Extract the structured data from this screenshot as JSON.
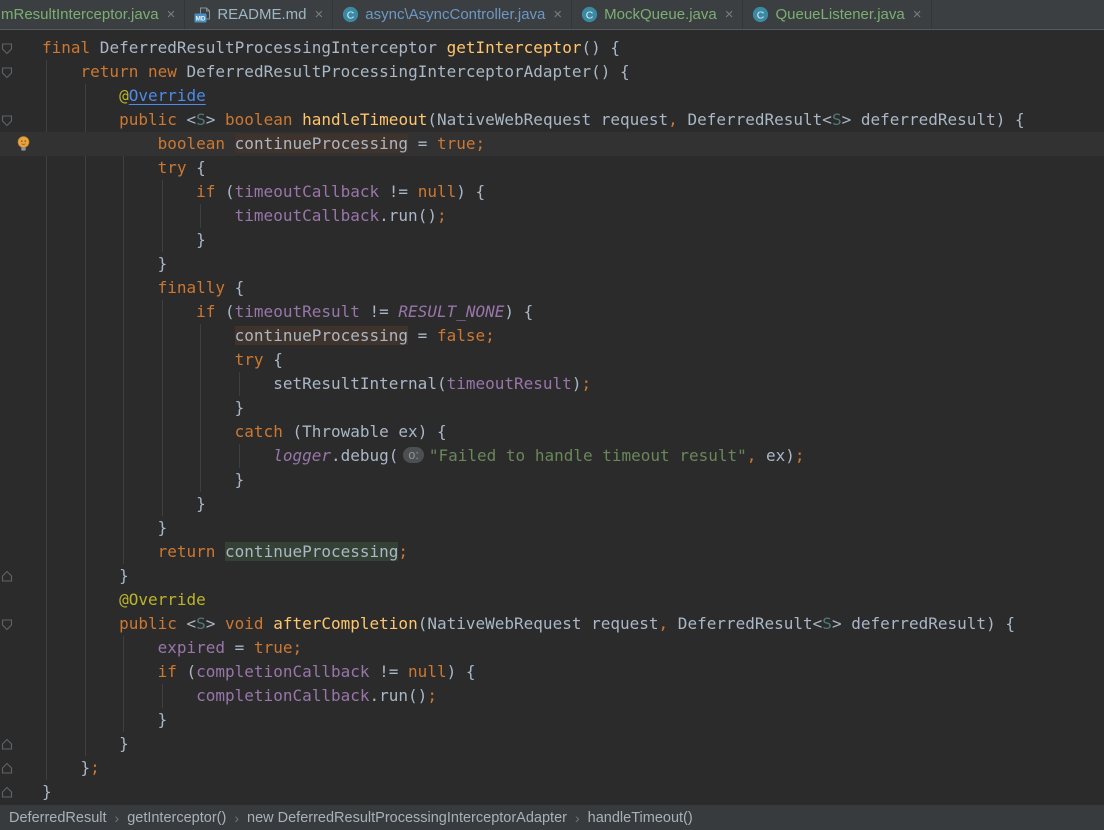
{
  "tab_bar": {
    "close_glyph": "×",
    "tabs": [
      {
        "label": "mResultInterceptor.java",
        "label_color": "#7CAE73",
        "icon": "none",
        "selected": true
      },
      {
        "label": "README.md",
        "label_color": "#9FB6C4",
        "icon": "markdown",
        "selected": false
      },
      {
        "label": "async\\AsyncController.java",
        "label_color": "#6D98C4",
        "icon": "class",
        "selected": false
      },
      {
        "label": "MockQueue.java",
        "label_color": "#7CAE73",
        "icon": "class",
        "selected": false
      },
      {
        "label": "QueueListener.java",
        "label_color": "#7CAE73",
        "icon": "class",
        "selected": false
      }
    ]
  },
  "editor": {
    "caret_line": 5,
    "lines": [
      {
        "g": "fold-down",
        "t": [
          [
            "kw",
            "final"
          ],
          [
            "txt",
            " DeferredResultProcessingInterceptor "
          ],
          [
            "m",
            "getInterceptor"
          ],
          [
            "txt",
            "() {"
          ]
        ]
      },
      {
        "g": "fold-down",
        "t": [
          [
            "txt",
            "    "
          ],
          [
            "kw",
            "return"
          ],
          [
            "txt",
            " "
          ],
          [
            "kw",
            "new"
          ],
          [
            "txt",
            " DeferredResultProcessingInterceptorAdapter() {"
          ]
        ]
      },
      {
        "g": null,
        "t": [
          [
            "txt",
            "        "
          ],
          [
            "ann",
            "@"
          ],
          [
            "link",
            "Override"
          ]
        ]
      },
      {
        "g": "fold-down",
        "t": [
          [
            "txt",
            "        "
          ],
          [
            "kw",
            "public"
          ],
          [
            "txt",
            " <"
          ],
          [
            "tp",
            "S"
          ],
          [
            "txt",
            "> "
          ],
          [
            "kw",
            "boolean"
          ],
          [
            "txt",
            " "
          ],
          [
            "m",
            "handleTimeout"
          ],
          [
            "txt",
            "(NativeWebRequest request"
          ],
          [
            "kw",
            ","
          ],
          [
            "txt",
            " DeferredResult<"
          ],
          [
            "tp",
            "S"
          ],
          [
            "txt",
            "> deferredResult) {"
          ]
        ]
      },
      {
        "g": "bulb",
        "cur": true,
        "t": [
          [
            "txt",
            "            "
          ],
          [
            "kw",
            "boolean"
          ],
          [
            "txt",
            " "
          ],
          [
            "caret",
            ""
          ],
          [
            "wr",
            "continueProcessing"
          ],
          [
            "txt",
            " = "
          ],
          [
            "kw",
            "true"
          ],
          [
            "kw",
            ";"
          ]
        ]
      },
      {
        "g": null,
        "t": [
          [
            "txt",
            "            "
          ],
          [
            "kw",
            "try"
          ],
          [
            "txt",
            " {"
          ]
        ]
      },
      {
        "g": null,
        "t": [
          [
            "txt",
            "                "
          ],
          [
            "kw",
            "if"
          ],
          [
            "txt",
            " ("
          ],
          [
            "fld",
            "timeoutCallback"
          ],
          [
            "txt",
            " != "
          ],
          [
            "kw",
            "null"
          ],
          [
            "txt",
            ") {"
          ]
        ]
      },
      {
        "g": null,
        "t": [
          [
            "txt",
            "                    "
          ],
          [
            "fld",
            "timeoutCallback"
          ],
          [
            "txt",
            ".run()"
          ],
          [
            "kw",
            ";"
          ]
        ]
      },
      {
        "g": null,
        "t": [
          [
            "txt",
            "                }"
          ]
        ]
      },
      {
        "g": null,
        "t": [
          [
            "txt",
            "            }"
          ]
        ]
      },
      {
        "g": null,
        "t": [
          [
            "txt",
            "            "
          ],
          [
            "kw",
            "finally"
          ],
          [
            "txt",
            " {"
          ]
        ]
      },
      {
        "g": null,
        "t": [
          [
            "txt",
            "                "
          ],
          [
            "kw",
            "if"
          ],
          [
            "txt",
            " ("
          ],
          [
            "fld",
            "timeoutResult"
          ],
          [
            "txt",
            " != "
          ],
          [
            "cst",
            "RESULT_NONE"
          ],
          [
            "txt",
            ") {"
          ]
        ]
      },
      {
        "g": null,
        "t": [
          [
            "txt",
            "                    "
          ],
          [
            "wr",
            "continueProcessing"
          ],
          [
            "txt",
            " = "
          ],
          [
            "kw",
            "false"
          ],
          [
            "kw",
            ";"
          ]
        ]
      },
      {
        "g": null,
        "t": [
          [
            "txt",
            "                    "
          ],
          [
            "kw",
            "try"
          ],
          [
            "txt",
            " {"
          ]
        ]
      },
      {
        "g": null,
        "t": [
          [
            "txt",
            "                        setResultInternal("
          ],
          [
            "fld",
            "timeoutResult"
          ],
          [
            "txt",
            ")"
          ],
          [
            "kw",
            ";"
          ]
        ]
      },
      {
        "g": null,
        "t": [
          [
            "txt",
            "                    }"
          ]
        ]
      },
      {
        "g": null,
        "t": [
          [
            "txt",
            "                    "
          ],
          [
            "kw",
            "catch"
          ],
          [
            "txt",
            " (Throwable ex) {"
          ]
        ]
      },
      {
        "g": null,
        "t": [
          [
            "txt",
            "                        "
          ],
          [
            "cst",
            "logger"
          ],
          [
            "txt",
            ".debug("
          ],
          [
            "hint",
            "o:"
          ],
          [
            "str",
            "\"Failed to handle timeout result\""
          ],
          [
            "kw",
            ","
          ],
          [
            "txt",
            " ex)"
          ],
          [
            "kw",
            ";"
          ]
        ]
      },
      {
        "g": null,
        "t": [
          [
            "txt",
            "                    }"
          ]
        ]
      },
      {
        "g": null,
        "t": [
          [
            "txt",
            "                }"
          ]
        ]
      },
      {
        "g": null,
        "t": [
          [
            "txt",
            "            }"
          ]
        ]
      },
      {
        "g": null,
        "t": [
          [
            "txt",
            "            "
          ],
          [
            "kw",
            "return"
          ],
          [
            "txt",
            " "
          ],
          [
            "rd",
            "continueProcessing"
          ],
          [
            "kw",
            ";"
          ]
        ]
      },
      {
        "g": "fold-up",
        "t": [
          [
            "txt",
            "        }"
          ]
        ]
      },
      {
        "g": null,
        "t": [
          [
            "txt",
            "        "
          ],
          [
            "ann",
            "@Override"
          ]
        ]
      },
      {
        "g": "fold-down",
        "t": [
          [
            "txt",
            "        "
          ],
          [
            "kw",
            "public"
          ],
          [
            "txt",
            " <"
          ],
          [
            "tp",
            "S"
          ],
          [
            "txt",
            "> "
          ],
          [
            "kw",
            "void"
          ],
          [
            "txt",
            " "
          ],
          [
            "m",
            "afterCompletion"
          ],
          [
            "txt",
            "(NativeWebRequest request"
          ],
          [
            "kw",
            ","
          ],
          [
            "txt",
            " DeferredResult<"
          ],
          [
            "tp",
            "S"
          ],
          [
            "txt",
            "> deferredResult) {"
          ]
        ]
      },
      {
        "g": null,
        "t": [
          [
            "txt",
            "            "
          ],
          [
            "fld",
            "expired"
          ],
          [
            "txt",
            " = "
          ],
          [
            "kw",
            "true"
          ],
          [
            "kw",
            ";"
          ]
        ]
      },
      {
        "g": null,
        "t": [
          [
            "txt",
            "            "
          ],
          [
            "kw",
            "if"
          ],
          [
            "txt",
            " ("
          ],
          [
            "fld",
            "completionCallback"
          ],
          [
            "txt",
            " != "
          ],
          [
            "kw",
            "null"
          ],
          [
            "txt",
            ") {"
          ]
        ]
      },
      {
        "g": null,
        "t": [
          [
            "txt",
            "                "
          ],
          [
            "fld",
            "completionCallback"
          ],
          [
            "txt",
            ".run()"
          ],
          [
            "kw",
            ";"
          ]
        ]
      },
      {
        "g": null,
        "t": [
          [
            "txt",
            "            }"
          ]
        ]
      },
      {
        "g": "fold-up",
        "t": [
          [
            "txt",
            "        }"
          ]
        ]
      },
      {
        "g": "fold-up",
        "t": [
          [
            "txt",
            "    }"
          ],
          [
            "kw",
            ";"
          ]
        ]
      },
      {
        "g": "fold-up",
        "t": [
          [
            "txt",
            "}"
          ]
        ]
      }
    ],
    "guides": [
      {
        "col": 0,
        "from": 2,
        "to": 31
      },
      {
        "col": 4,
        "from": 3,
        "to": 30
      },
      {
        "col": 8,
        "from": 5,
        "to": 22
      },
      {
        "col": 8,
        "from": 26,
        "to": 29
      },
      {
        "col": 12,
        "from": 7,
        "to": 9
      },
      {
        "col": 12,
        "from": 12,
        "to": 20
      },
      {
        "col": 12,
        "from": 28,
        "to": 28
      },
      {
        "col": 16,
        "from": 8,
        "to": 8
      },
      {
        "col": 16,
        "from": 13,
        "to": 19
      },
      {
        "col": 20,
        "from": 15,
        "to": 15
      },
      {
        "col": 20,
        "from": 18,
        "to": 18
      }
    ]
  },
  "breadcrumb_bar": {
    "separator": "›",
    "items": [
      "DeferredResult",
      "getInterceptor()",
      "new DeferredResultProcessingInterceptorAdapter",
      "handleTimeout()"
    ]
  },
  "colors": {
    "editor_bg": "#2b2b2b",
    "tab_bar_bg": "#3c3f41",
    "keyword": "#cc7832",
    "default_text": "#a9b7c6",
    "method_decl": "#ffc66d",
    "annotation": "#bbb529",
    "hyperlink": "#4e8ae8",
    "field": "#9876aa",
    "constant": "#9876aa",
    "string": "#6a8759",
    "type_parameter": "#507874",
    "write_access_highlight": "#40332b",
    "read_access_highlight": "#344134",
    "current_line": "#323232",
    "tab_added_file": "#7CAE73",
    "tab_modified_file": "#6D98C4"
  }
}
